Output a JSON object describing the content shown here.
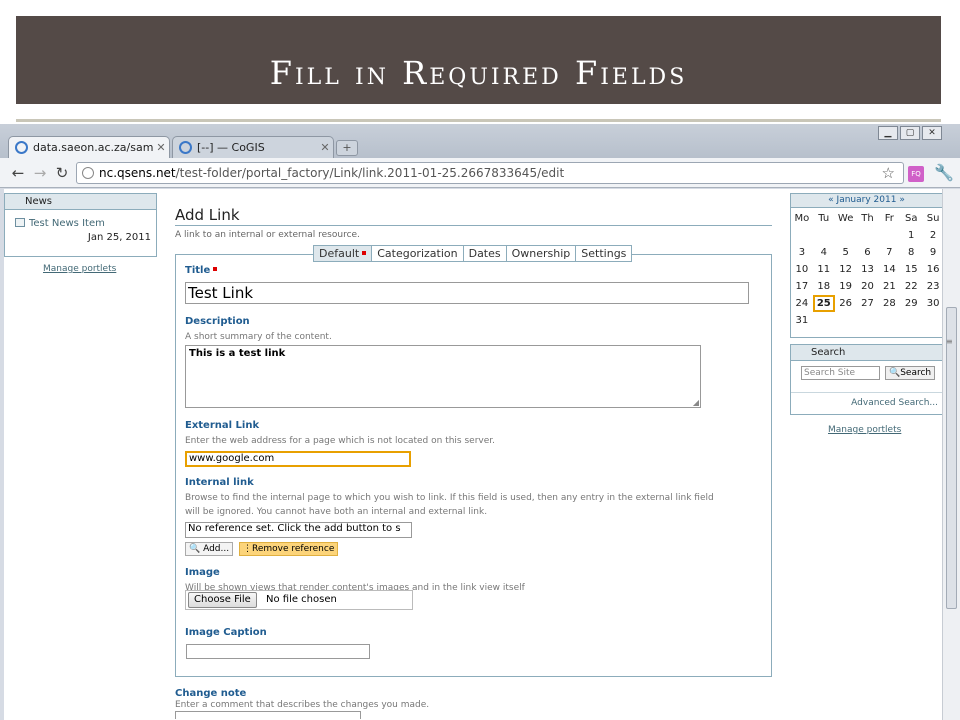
{
  "slide": {
    "title": "Fill in Required Fields"
  },
  "browser": {
    "tabs": [
      {
        "label": "data.saeon.ac.za/sample-...",
        "active": true
      },
      {
        "label": "[--] — CoGIS",
        "active": false
      }
    ],
    "url_host": "nc.qsens.net",
    "url_path": "/test-folder/portal_factory/Link/link.2011-01-25.2667833645/edit",
    "extension_label": "FQ"
  },
  "left_portlet": {
    "header": "News",
    "item_title": "Test News Item",
    "item_date": "Jan 25, 2011",
    "manage_link": "Manage portlets"
  },
  "page": {
    "title": "Add Link",
    "description": "A link to an internal or external resource.",
    "tabs": [
      "Default",
      "Categorization",
      "Dates",
      "Ownership",
      "Settings"
    ]
  },
  "form": {
    "title_label": "Title",
    "title_value": "Test Link",
    "description_label": "Description",
    "description_help": "A short summary of the content.",
    "description_value": "This is a test link",
    "external_label": "External Link",
    "external_help": "Enter the web address for a page which is not located on this server.",
    "external_value": "www.google.com",
    "internal_label": "Internal link",
    "internal_help_1": "Browse to find the internal page to which you wish to link. If this field is used, then any entry in the external link field",
    "internal_help_2": "will be ignored. You cannot have both an internal and external link.",
    "internal_value": "No reference set. Click the add button to s",
    "add_button": "Add...",
    "remove_button": "Remove reference",
    "image_label": "Image",
    "image_help": "Will be shown views that render content's images and in the link view itself",
    "choose_file_button": "Choose File",
    "file_status": "No file chosen",
    "caption_label": "Image Caption",
    "change_note_label": "Change note",
    "change_note_help": "Enter a comment that describes the changes you made."
  },
  "calendar": {
    "prev": "«",
    "month": "January 2011",
    "next": "»",
    "days_of_week": [
      "Mo",
      "Tu",
      "We",
      "Th",
      "Fr",
      "Sa",
      "Su"
    ],
    "leading_blanks": 5,
    "days": [
      1,
      2,
      3,
      4,
      5,
      6,
      7,
      8,
      9,
      10,
      11,
      12,
      13,
      14,
      15,
      16,
      17,
      18,
      19,
      20,
      21,
      22,
      23,
      24,
      25,
      26,
      27,
      28,
      29,
      30,
      31
    ],
    "today": 25
  },
  "search_portlet": {
    "header": "Search",
    "placeholder": "Search Site",
    "button": "Search",
    "advanced_link": "Advanced Search...",
    "manage_link": "Manage portlets"
  },
  "colors": {
    "title_bar": "#544a47",
    "portlet_border": "#8cacbb",
    "label_blue": "#205c90",
    "focus_orange": "#e8a000"
  }
}
